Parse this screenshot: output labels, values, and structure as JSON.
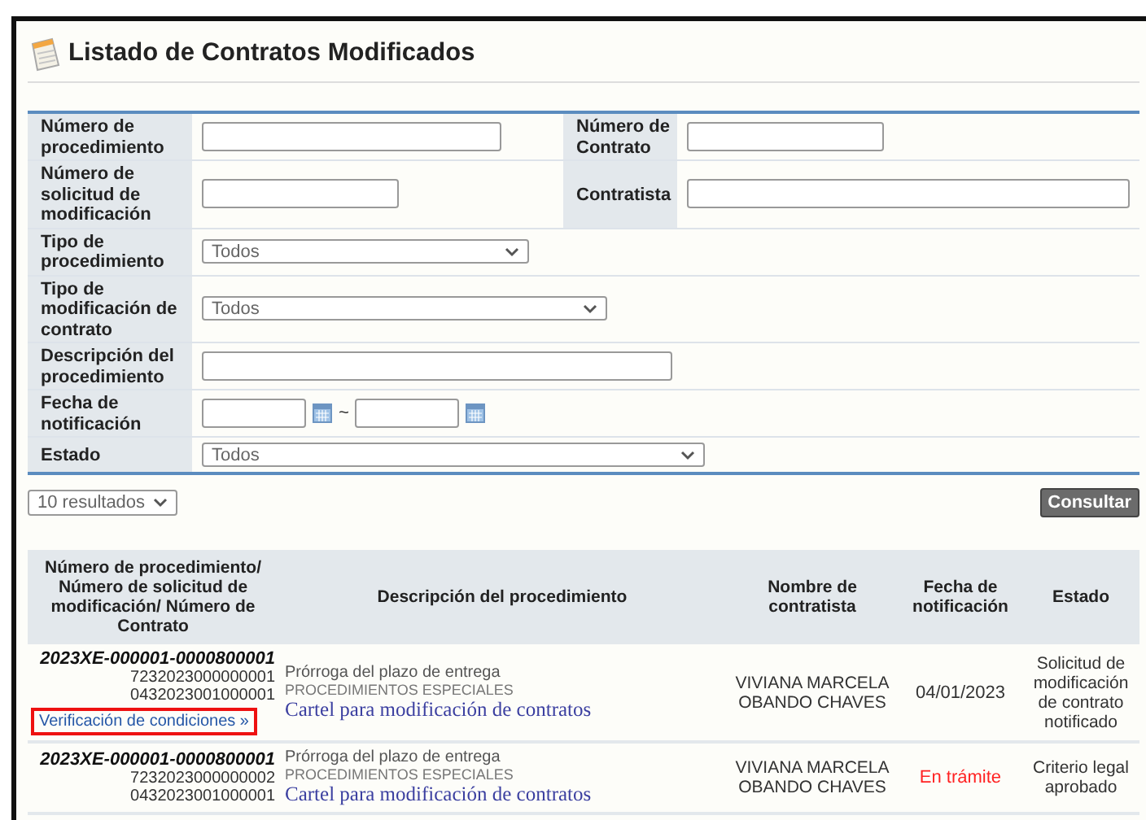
{
  "title": "Listado de Contratos Modificados",
  "filters": [
    {
      "kind": "text",
      "label": "Número de procedimiento",
      "pair": {
        "label": "Número de Contrato"
      }
    },
    {
      "kind": "text",
      "label": "Número de solicitud de modificación",
      "pair": {
        "label": "Contratista"
      }
    },
    {
      "kind": "select",
      "label": "Tipo de procedimiento",
      "value": "Todos"
    },
    {
      "kind": "select",
      "label": "Tipo de modificación de contrato",
      "value": "Todos"
    },
    {
      "kind": "text",
      "label": "Descripción del procedimiento"
    },
    {
      "kind": "daterange",
      "label": "Fecha de notificación",
      "separator": "~"
    },
    {
      "kind": "select",
      "label": "Estado",
      "value": "Todos"
    }
  ],
  "page_size": "10 resultados",
  "search_button": "Consultar",
  "table": {
    "columns": [
      "Número de procedimiento/ Número de solicitud de modificación/ Número de Contrato",
      "Descripción del procedimiento",
      "Nombre de contratista",
      "Fecha de notificación",
      "Estado"
    ],
    "rows": [
      {
        "procedimiento": "2023XE-000001-0000800001",
        "solicitud": "7232023000000001",
        "contrato": "0432023001000001",
        "link": {
          "text": "Verificación de condiciones »",
          "highlighted": true
        },
        "descripcion": "Prórroga del plazo de entrega",
        "tipo": "PROCEDIMIENTOS ESPECIALES",
        "cartel": "Cartel para modificación de contratos",
        "contratista": "VIVIANA MARCELA OBANDO CHAVES",
        "fecha": {
          "text": "04/01/2023",
          "kind": "date"
        },
        "estado": "Solicitud de modificación de contrato notificado"
      },
      {
        "procedimiento": "2023XE-000001-0000800001",
        "solicitud": "7232023000000002",
        "contrato": "0432023001000001",
        "descripcion": "Prórroga del plazo de entrega",
        "tipo": "PROCEDIMIENTOS ESPECIALES",
        "cartel": "Cartel para modificación de contratos",
        "contratista": "VIVIANA MARCELA OBANDO CHAVES",
        "fecha": {
          "text": "En trámite",
          "kind": "pending"
        },
        "estado": "Criterio legal aprobado"
      }
    ]
  }
}
